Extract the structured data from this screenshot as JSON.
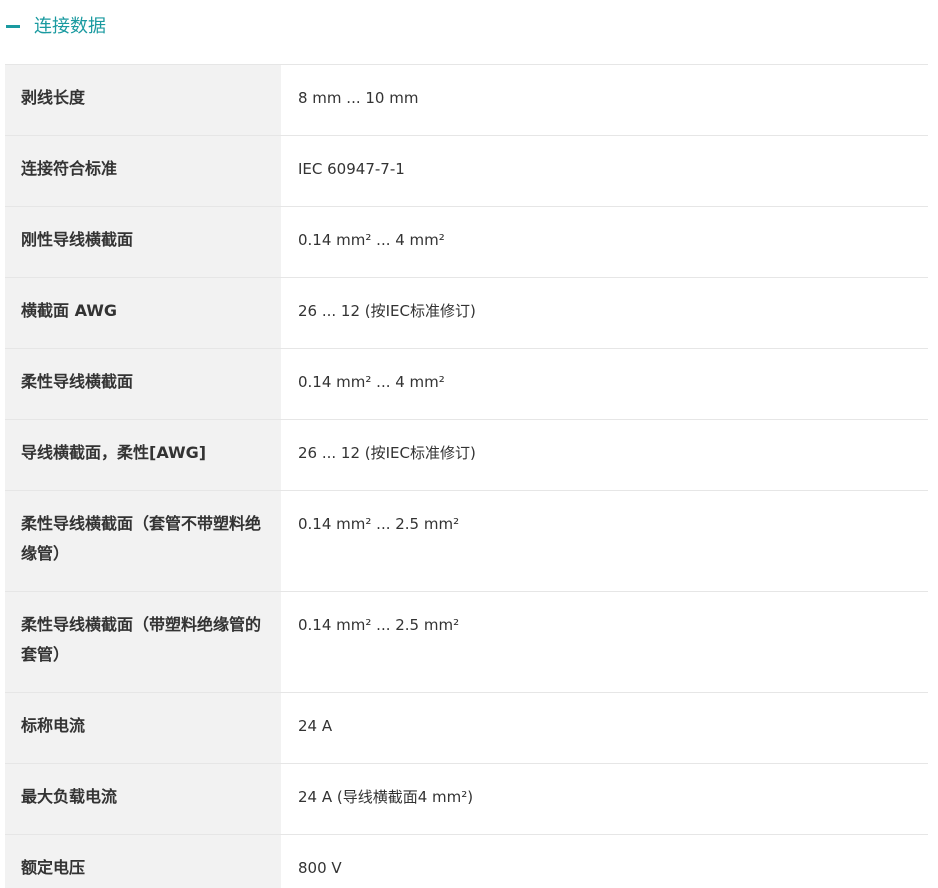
{
  "section": {
    "title": "连接数据",
    "collapse_icon": "minus-icon",
    "accent_color": "#1a9aa0"
  },
  "specs": [
    {
      "label": "剥线长度",
      "value": "8 mm ... 10 mm"
    },
    {
      "label": "连接符合标准",
      "value": "IEC 60947-7-1"
    },
    {
      "label": "刚性导线横截面",
      "value": "0.14 mm² ... 4 mm²"
    },
    {
      "label": "横截面 AWG",
      "value": "26 ... 12 (按IEC标准修订)"
    },
    {
      "label": "柔性导线横截面",
      "value": "0.14 mm² ... 4 mm²"
    },
    {
      "label": "导线横截面，柔性[AWG]",
      "value": "26 ... 12 (按IEC标准修订)"
    },
    {
      "label": "柔性导线横截面（套管不带塑料绝缘管）",
      "value": "0.14 mm² ... 2.5 mm²"
    },
    {
      "label": "柔性导线横截面（带塑料绝缘管的套管）",
      "value": "0.14 mm² ... 2.5 mm²"
    },
    {
      "label": "标称电流",
      "value": "24 A"
    },
    {
      "label": "最大负载电流",
      "value": "24 A (导线横截面4 mm²)"
    },
    {
      "label": "额定电压",
      "value": "800 V"
    }
  ]
}
